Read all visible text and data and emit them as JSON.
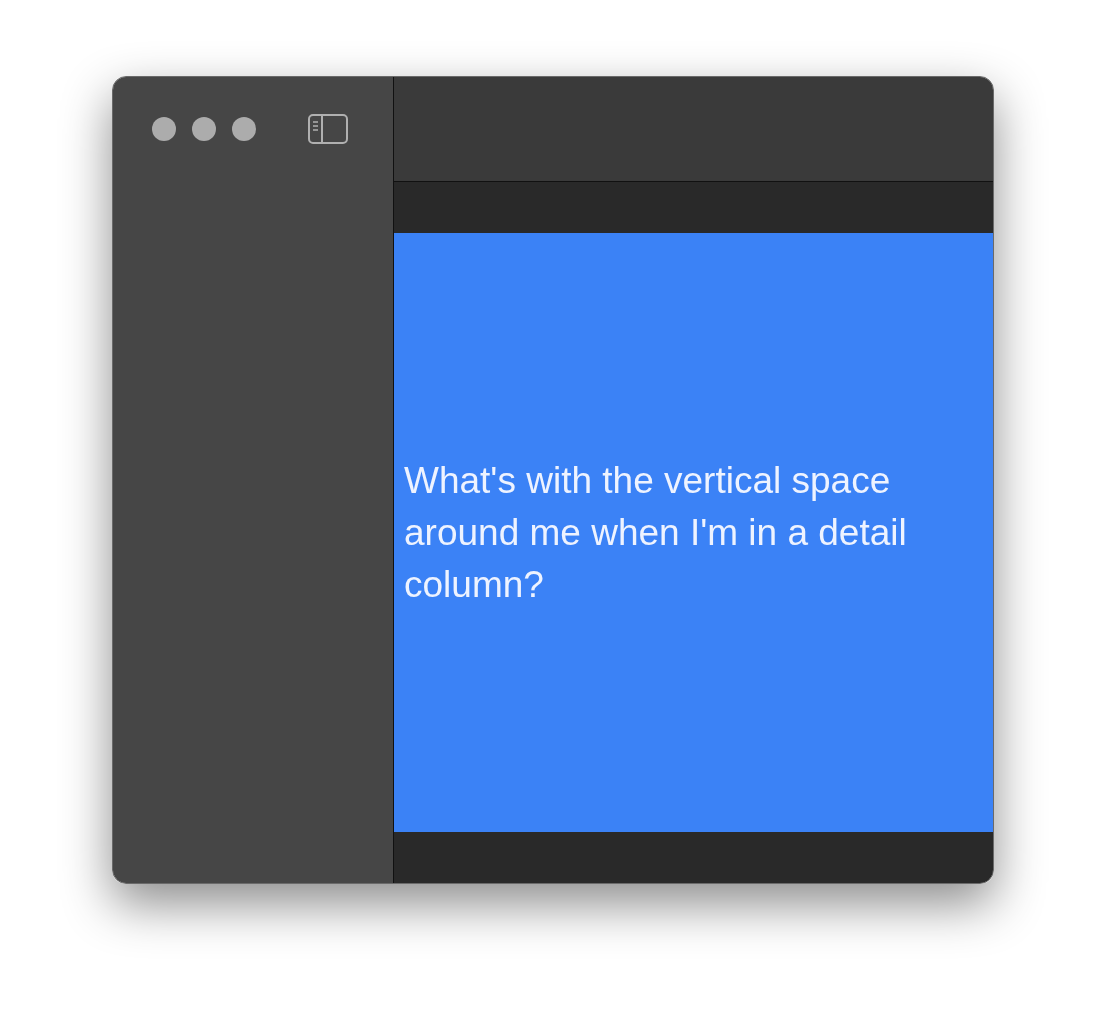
{
  "detail": {
    "text": "What's with the vertical space around me when I'm in a detail column?"
  }
}
